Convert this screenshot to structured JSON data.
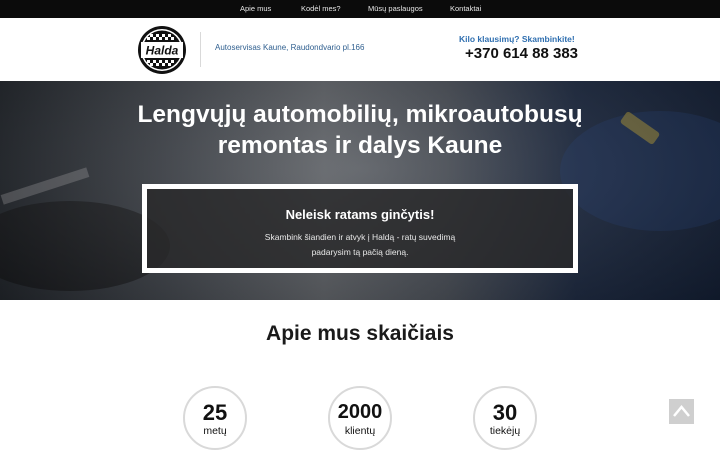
{
  "nav": {
    "items": [
      {
        "label": "Apie mus"
      },
      {
        "label": "Kodėl mes?"
      },
      {
        "label": "Mūsų paslaugos"
      },
      {
        "label": "Kontaktai"
      }
    ]
  },
  "header": {
    "logo_text": "Halda",
    "address": "Autoservisas Kaune, Raudondvario pl.166",
    "ask": "Kilo klausimų? Skambinkite!",
    "phone": "+370 614 88 383"
  },
  "hero": {
    "title_line1": "Lengvųjų automobilių, mikroautobusų",
    "title_line2": "remontas ir dalys Kaune",
    "promo": {
      "title": "Neleisk ratams ginčytis!",
      "text_line1": "Skambink šiandien ir atvyk į Haldą - ratų suvedimą",
      "text_line2": "padarysim tą pačią dieną."
    }
  },
  "stats": {
    "title": "Apie mus skaičiais",
    "items": [
      {
        "value": "25",
        "label": "metų"
      },
      {
        "value": "2000",
        "label": "klientų"
      },
      {
        "value": "30",
        "label": "tiekėjų"
      }
    ]
  },
  "icons": {
    "scroll_top": "chevron-up-icon"
  },
  "colors": {
    "nav_bg": "#0b0b0b",
    "accent_blue": "#2f6fb0",
    "promo_border": "#ffffff"
  }
}
